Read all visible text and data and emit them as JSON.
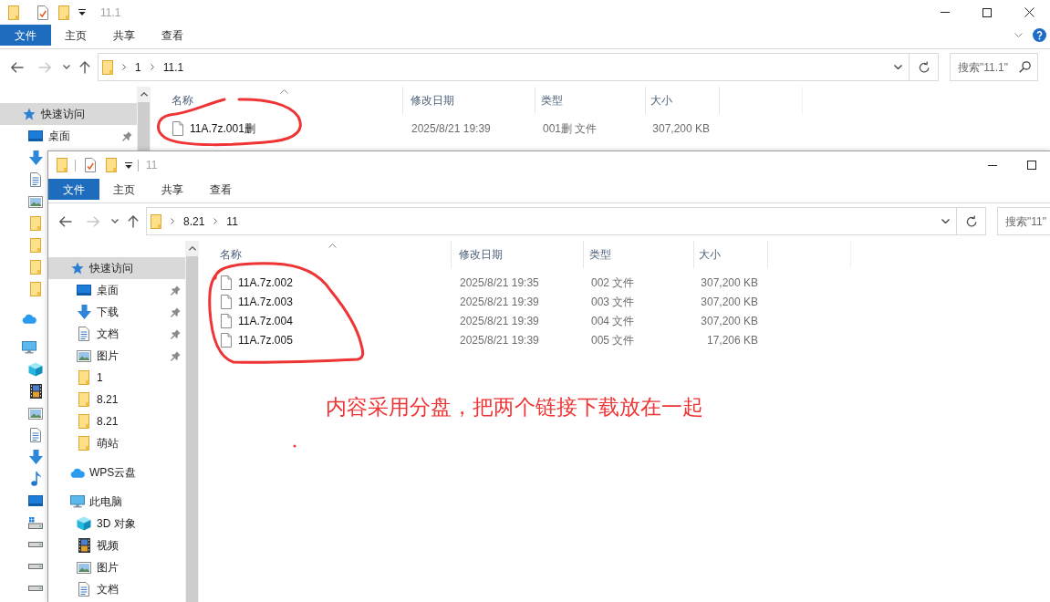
{
  "back_window": {
    "title": "11.1",
    "ribbon_tabs": [
      {
        "label": "文件",
        "kind": "menu"
      },
      {
        "label": "主页",
        "kind": "tab"
      },
      {
        "label": "共享",
        "kind": "tab"
      },
      {
        "label": "查看",
        "kind": "tab"
      }
    ],
    "nav_buttons": [
      {
        "kind": "back",
        "disabled": false
      },
      {
        "kind": "forward",
        "disabled": true
      },
      {
        "kind": "recent",
        "disabled": false
      },
      {
        "kind": "up",
        "disabled": false
      }
    ],
    "address": {
      "path": [
        "1",
        "11.1"
      ]
    },
    "search": {
      "placeholder": "搜索\"11.1\""
    },
    "sidebar": [
      {
        "label": "快速访问",
        "kind": "quick-access",
        "selected": true,
        "children": [
          {
            "label": "桌面",
            "kind": "desktop",
            "selected": false,
            "pinned": true
          },
          {
            "kind": "download",
            "selected": false
          },
          {
            "kind": "document",
            "selected": false
          },
          {
            "kind": "picture",
            "selected": false
          },
          {
            "kind": "folder",
            "selected": false
          },
          {
            "kind": "folder",
            "selected": false
          },
          {
            "kind": "folder",
            "selected": false
          },
          {
            "kind": "folder",
            "selected": false
          }
        ]
      },
      {
        "kind": "cloud",
        "selected": false
      },
      {
        "kind": "pc",
        "selected": false,
        "children": [
          {
            "kind": "cube",
            "selected": false
          },
          {
            "kind": "video",
            "selected": false
          },
          {
            "kind": "picture",
            "selected": false
          },
          {
            "kind": "document",
            "selected": false
          },
          {
            "kind": "download",
            "selected": false
          },
          {
            "kind": "music",
            "selected": false
          },
          {
            "kind": "desktop",
            "selected": false
          },
          {
            "kind": "system-drive",
            "selected": false
          },
          {
            "kind": "drive",
            "selected": false
          },
          {
            "kind": "drive",
            "selected": false
          },
          {
            "kind": "drive",
            "selected": false
          }
        ]
      }
    ],
    "columns": [
      {
        "label": "名称",
        "sorted": true
      },
      {
        "label": "修改日期",
        "sorted": false
      },
      {
        "label": "类型",
        "sorted": false
      },
      {
        "label": "大小",
        "sorted": false
      }
    ],
    "files": [
      {
        "name": "11A.7z.001删",
        "modified": "2025/8/21 19:39",
        "type": "001删 文件",
        "size": "307,200 KB"
      }
    ]
  },
  "front_window": {
    "title": "11",
    "ribbon_tabs": [
      {
        "label": "文件",
        "kind": "menu"
      },
      {
        "label": "主页",
        "kind": "tab"
      },
      {
        "label": "共享",
        "kind": "tab"
      },
      {
        "label": "查看",
        "kind": "tab"
      }
    ],
    "nav_buttons": [
      {
        "kind": "back",
        "disabled": false
      },
      {
        "kind": "forward",
        "disabled": true
      },
      {
        "kind": "recent",
        "disabled": false
      },
      {
        "kind": "up",
        "disabled": false
      }
    ],
    "address": {
      "path": [
        "8.21",
        "11"
      ]
    },
    "search": {
      "placeholder": "搜索\"11\""
    },
    "sidebar": [
      {
        "label": "快速访问",
        "kind": "quick-access",
        "selected": true,
        "children": [
          {
            "label": "桌面",
            "kind": "desktop",
            "selected": false,
            "pinned": true
          },
          {
            "label": "下载",
            "kind": "download",
            "selected": false,
            "pinned": true
          },
          {
            "label": "文档",
            "kind": "document",
            "selected": false,
            "pinned": true
          },
          {
            "label": "图片",
            "kind": "picture",
            "selected": false,
            "pinned": true
          },
          {
            "label": "1",
            "kind": "folder",
            "selected": false,
            "pinned": false
          },
          {
            "label": "8.21",
            "kind": "folder",
            "selected": false,
            "pinned": false
          },
          {
            "label": "8.21",
            "kind": "folder",
            "selected": false,
            "pinned": false
          },
          {
            "label": "萌站",
            "kind": "folder",
            "selected": false,
            "pinned": false
          }
        ]
      },
      {
        "label": "WPS云盘",
        "kind": "cloud",
        "selected": false
      },
      {
        "label": "此电脑",
        "kind": "pc",
        "selected": false,
        "children": [
          {
            "label": "3D 对象",
            "kind": "cube",
            "selected": false
          },
          {
            "label": "视频",
            "kind": "video",
            "selected": false
          },
          {
            "label": "图片",
            "kind": "picture",
            "selected": false
          },
          {
            "label": "文档",
            "kind": "document",
            "selected": false
          }
        ]
      }
    ],
    "columns": [
      {
        "label": "名称",
        "sorted": true
      },
      {
        "label": "修改日期",
        "sorted": false
      },
      {
        "label": "类型",
        "sorted": false
      },
      {
        "label": "大小",
        "sorted": false
      }
    ],
    "files": [
      {
        "name": "11A.7z.002",
        "modified": "2025/8/21 19:35",
        "type": "002 文件",
        "size": "307,200 KB"
      },
      {
        "name": "11A.7z.003",
        "modified": "2025/8/21 19:39",
        "type": "003 文件",
        "size": "307,200 KB"
      },
      {
        "name": "11A.7z.004",
        "modified": "2025/8/21 19:39",
        "type": "004 文件",
        "size": "307,200 KB"
      },
      {
        "name": "11A.7z.005",
        "modified": "2025/8/21 19:39",
        "type": "005 文件",
        "size": "17,206 KB"
      }
    ]
  },
  "annotation": {
    "note": "内容采用分盘，把两个链接下载放在一起"
  }
}
